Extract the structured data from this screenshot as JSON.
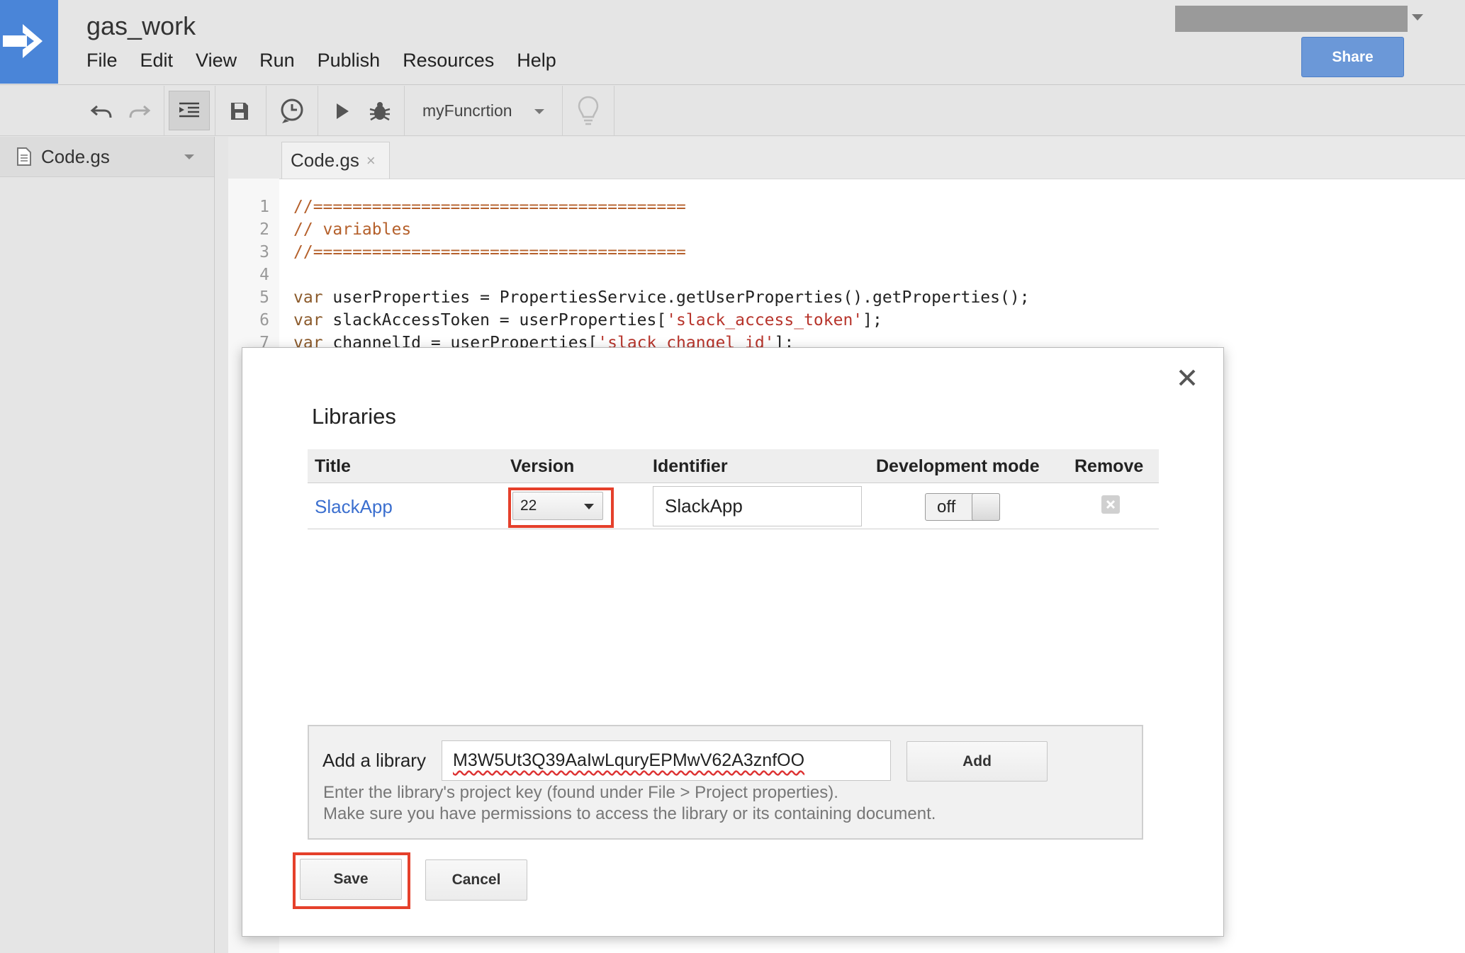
{
  "window": {
    "title": "gas_work"
  },
  "menu": [
    "File",
    "Edit",
    "View",
    "Run",
    "Publish",
    "Resources",
    "Help"
  ],
  "header": {
    "share_label": "Share"
  },
  "toolbar": {
    "function_select": "myFuncrtion"
  },
  "sidebar": {
    "files": [
      {
        "name": "Code.gs"
      }
    ]
  },
  "editor": {
    "tab": {
      "name": "Code.gs",
      "close_glyph": "×"
    },
    "lines": [
      {
        "num": "1",
        "parts": [
          {
            "t": "//======================================",
            "c": "comment"
          }
        ]
      },
      {
        "num": "2",
        "parts": [
          {
            "t": "// variables",
            "c": "comment"
          }
        ]
      },
      {
        "num": "3",
        "parts": [
          {
            "t": "//======================================",
            "c": "comment"
          }
        ]
      },
      {
        "num": "4",
        "parts": []
      },
      {
        "num": "5",
        "parts": [
          {
            "t": "var",
            "c": "kw"
          },
          {
            "t": " userProperties = PropertiesService.getUserProperties().getProperties();",
            "c": "plain"
          }
        ]
      },
      {
        "num": "6",
        "parts": [
          {
            "t": "var",
            "c": "kw"
          },
          {
            "t": " slackAccessToken = userProperties[",
            "c": "plain"
          },
          {
            "t": "'slack_access_token'",
            "c": "str"
          },
          {
            "t": "];",
            "c": "plain"
          }
        ]
      },
      {
        "num": "7",
        "parts": [
          {
            "t": "var",
            "c": "kw"
          },
          {
            "t": " channelId = userProperties[",
            "c": "plain"
          },
          {
            "t": "'slack_changel_id'",
            "c": "str"
          },
          {
            "t": "];",
            "c": "plain"
          }
        ]
      }
    ]
  },
  "dialog": {
    "title": "Libraries",
    "close_glyph": "×",
    "columns": [
      "Title",
      "Version",
      "Identifier",
      "Development mode",
      "Remove"
    ],
    "libraries": [
      {
        "title": "SlackApp",
        "version": "22",
        "identifier": "SlackApp",
        "dev_mode": "off"
      }
    ],
    "add_library": {
      "label": "Add a library",
      "value": "M3W5Ut3Q39AaIwLquryEPMwV62A3znfOO",
      "button": "Add",
      "hint_line1": "Enter the library's project key (found under File > Project properties).",
      "hint_line2": "Make sure you have permissions to access the library or its containing document."
    },
    "save_label": "Save",
    "cancel_label": "Cancel"
  },
  "colors": {
    "accent": "#4a85d8",
    "share": "#6b98d8",
    "link": "#3b6fcf",
    "highlight": "#e5402b"
  }
}
